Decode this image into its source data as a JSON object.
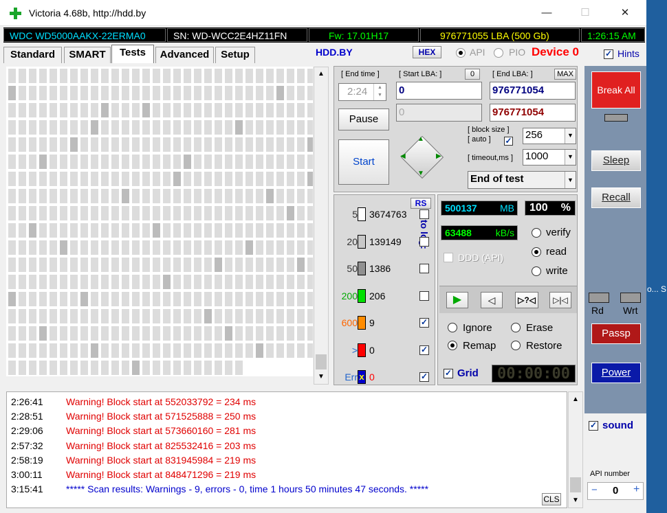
{
  "titlebar": {
    "title": "Victoria 4.68b, http://hdd.by",
    "min": "—",
    "max": "☐",
    "close": "✕"
  },
  "info": {
    "model": "WDC WD5000AAKX-22ERMA0",
    "serial": "SN: WD-WCC2E4HZ11FN",
    "firmware": "Fw: 17.01H17",
    "lba": "976771055 LBA (500 Gb)",
    "clock": "1:26:15 AM"
  },
  "tabs": [
    "Standard",
    "SMART",
    "Tests",
    "Advanced",
    "Setup"
  ],
  "header": {
    "hddby": "HDD.BY",
    "hex": "HEX",
    "api": "API",
    "pio": "PIO",
    "device": "Device 0",
    "hints": "Hints"
  },
  "range": {
    "end_time_label": "[ End time ]",
    "start_lba_label": "[ Start LBA: ]",
    "zero_btn": "0",
    "end_lba_label": "[ End LBA: ]",
    "max_btn": "MAX",
    "end_time": "2:24",
    "start_lba": "0",
    "end_lba": "976771054",
    "cur_lba": "0",
    "cur_end": "976771054"
  },
  "controls": {
    "pause": "Pause",
    "start": "Start",
    "block_size_label1": "[ block size ]",
    "block_size_label2": "[ auto ]",
    "block_size": "256",
    "timeout_label": "[ timeout,ms ]",
    "timeout": "1000",
    "mode": "End of test"
  },
  "stats": {
    "rs": "RS",
    "to_log": "to log:",
    "rows": [
      {
        "label": "5",
        "count": "3674763",
        "color": "#ffffff",
        "checked": false
      },
      {
        "label": "20",
        "count": "139149",
        "color": "#c8c8c8",
        "checked": false
      },
      {
        "label": "50",
        "count": "1386",
        "color": "#909090",
        "checked": false
      },
      {
        "label": "200",
        "count": "206",
        "color": "#00e000",
        "checked": false
      },
      {
        "label": "600",
        "count": "9",
        "color": "#ff8c00",
        "checked": true
      },
      {
        "label": ">",
        "count": "0",
        "color": "#ff0000",
        "checked": true
      },
      {
        "label": "Err",
        "count": "0",
        "color": "#0000cc",
        "checked": true
      }
    ]
  },
  "progress": {
    "mb": "500137",
    "mb_unit": "MB",
    "pct": "100",
    "pct_unit": "%",
    "speed": "63488",
    "speed_unit": "kB/s",
    "verify": "verify",
    "read": "read",
    "write": "write",
    "ddd": "DDD (API)"
  },
  "actions": {
    "ignore": "Ignore",
    "erase": "Erase",
    "remap": "Remap",
    "restore": "Restore",
    "grid": "Grid",
    "timer": "00:00:00"
  },
  "side": {
    "break_all": "Break All",
    "sleep": "Sleep",
    "recall": "Recall",
    "rd": "Rd",
    "wrt": "Wrt",
    "passp": "Passp",
    "power": "Power",
    "sound": "sound",
    "api_number": "API number",
    "api_value": "0",
    "minus": "−",
    "plus": "+"
  },
  "log": {
    "cls": "CLS",
    "rows": [
      {
        "time": "2:26:41",
        "msg": "Warning! Block start at 552033792 = 234 ms",
        "color": "#e00000"
      },
      {
        "time": "2:28:51",
        "msg": "Warning! Block start at 571525888 = 250 ms",
        "color": "#e00000"
      },
      {
        "time": "2:29:06",
        "msg": "Warning! Block start at 573660160 = 281 ms",
        "color": "#e00000"
      },
      {
        "time": "2:57:32",
        "msg": "Warning! Block start at 825532416 = 203 ms",
        "color": "#e00000"
      },
      {
        "time": "2:58:19",
        "msg": "Warning! Block start at 831945984 = 219 ms",
        "color": "#e00000"
      },
      {
        "time": "3:00:11",
        "msg": "Warning! Block start at 848471296 = 219 ms",
        "color": "#e00000"
      },
      {
        "time": "3:15:41",
        "msg": "***** Scan results: Warnings - 9, errors - 0, time 1 hours 50 minutes 47 seconds.  *****",
        "color": "#0000cc"
      }
    ]
  },
  "desktop": {
    "edge_text": "o... S"
  }
}
